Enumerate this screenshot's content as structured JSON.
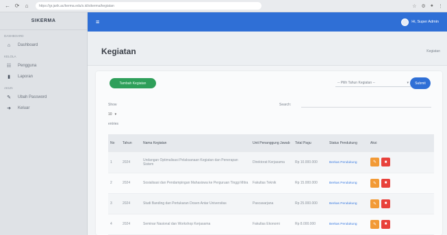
{
  "browser": {
    "url": "https://gr.jarik.ac/kerma.edu/s.id/sikerma/kegiatan",
    "back": "←",
    "refresh": "⟳",
    "home": "⌂"
  },
  "sidebar": {
    "brand": "SIKERMA",
    "sections": [
      {
        "label": "Dashboard",
        "items": [
          {
            "icon": "home-icon",
            "glyph": "⌂",
            "label": "Dashboard"
          }
        ]
      },
      {
        "label": "Kelola",
        "items": [
          {
            "icon": "users-icon",
            "glyph": "☷",
            "label": "Pengguna"
          },
          {
            "icon": "report-icon",
            "glyph": "▮",
            "label": "Laporan"
          }
        ]
      },
      {
        "label": "Akun",
        "items": [
          {
            "icon": "wrench-icon",
            "glyph": "✎",
            "label": "Ubah Password"
          },
          {
            "icon": "logout-icon",
            "glyph": "➜",
            "label": "Keluar"
          }
        ]
      }
    ]
  },
  "topbar": {
    "menu_glyph": "≡",
    "user_name": "Hi, Super Admin"
  },
  "page": {
    "title": "Kegiatan",
    "breadcrumb": "Kegiatan"
  },
  "toolbar": {
    "add_label": "Tambah Kegiatan",
    "year_value": "-- Pilih Tahun Kegiatan --",
    "submit_label": "Submit"
  },
  "list": {
    "show_label": "Show",
    "show_value": "10",
    "entries_label": "entries",
    "search_label": "Search:"
  },
  "table": {
    "headers": [
      "No",
      "Tahun",
      "Nama Kegiatan",
      "Unit Penanggung Jawab",
      "Total Pagu",
      "Status Pendukung",
      "Aksi"
    ],
    "rows": [
      {
        "no": "1",
        "year": "2024",
        "name": "Undangan Optimalisasi Pelaksanaan Kegiatan dan Penerapan Sistem",
        "unit": "Direktorat Kerjasama",
        "total": "Rp 10.000.000",
        "status": "Berkas Pendukung"
      },
      {
        "no": "2",
        "year": "2024",
        "name": "Sosialisasi dan Pendampingan Mahasiswa ke Perguruan Tinggi Mitra",
        "unit": "Fakultas Teknik",
        "total": "Rp 15.000.000",
        "status": "Berkas Pendukung"
      },
      {
        "no": "3",
        "year": "2024",
        "name": "Studi Banding dan Pertukaran Dosen Antar Universitas",
        "unit": "Pascasarjana",
        "total": "Rp 25.000.000",
        "status": "Berkas Pendukung"
      },
      {
        "no": "4",
        "year": "2024",
        "name": "Seminar Nasional dan Workshop Kerjasama",
        "unit": "Fakultas Ekonomi",
        "total": "Rp 8.000.000",
        "status": "Berkas Pendukung"
      }
    ]
  },
  "colors": {
    "primary": "#2f6fd6",
    "add_button": "#2e9f5a",
    "edit_button": "#f29a36",
    "delete_button": "#e8413b"
  }
}
